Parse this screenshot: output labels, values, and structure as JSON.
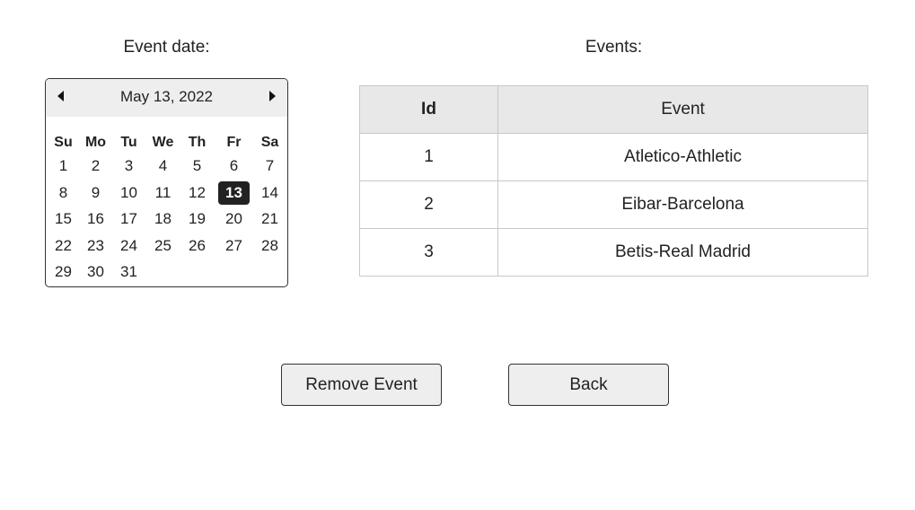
{
  "labels": {
    "event_date": "Event date:",
    "events": "Events:"
  },
  "calendar": {
    "title": "May 13, 2022",
    "selected_day": "13",
    "weekdays": [
      "Su",
      "Mo",
      "Tu",
      "We",
      "Th",
      "Fr",
      "Sa"
    ],
    "weeks": [
      [
        "1",
        "2",
        "3",
        "4",
        "5",
        "6",
        "7"
      ],
      [
        "8",
        "9",
        "10",
        "11",
        "12",
        "13",
        "14"
      ],
      [
        "15",
        "16",
        "17",
        "18",
        "19",
        "20",
        "21"
      ],
      [
        "22",
        "23",
        "24",
        "25",
        "26",
        "27",
        "28"
      ],
      [
        "29",
        "30",
        "31",
        "",
        "",
        "",
        ""
      ]
    ],
    "prev_icon": "triangle-left",
    "next_icon": "triangle-right"
  },
  "table": {
    "headers": [
      "Id",
      "Event"
    ],
    "rows": [
      [
        "1",
        "Atletico-Athletic"
      ],
      [
        "2",
        "Eibar-Barcelona"
      ],
      [
        "3",
        "Betis-Real Madrid"
      ]
    ]
  },
  "buttons": {
    "remove": "Remove Event",
    "back": "Back"
  }
}
